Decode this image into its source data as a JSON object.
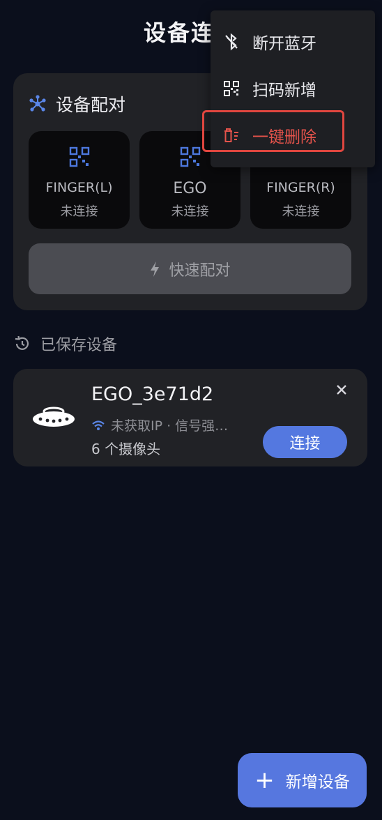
{
  "header": {
    "title": "设备连接"
  },
  "pairing": {
    "title": "设备配对",
    "devices": [
      {
        "name": "FINGER(L)",
        "status": "未连接"
      },
      {
        "name": "EGO",
        "status": "未连接"
      },
      {
        "name": "FINGER(R)",
        "status": "未连接"
      }
    ],
    "quick_pair_label": "快速配对"
  },
  "saved": {
    "title": "已保存设备",
    "device": {
      "name": "EGO_3e71d2",
      "meta": "未获取IP · 信号强…",
      "cameras": "6 个摄像头",
      "connect_label": "连接"
    }
  },
  "fab": {
    "label": "新增设备"
  },
  "menu": {
    "items": [
      {
        "label": "断开蓝牙",
        "icon": "bluetooth-off-icon"
      },
      {
        "label": "扫码新增",
        "icon": "qr-scan-icon"
      },
      {
        "label": "一键删除",
        "icon": "delete-all-icon"
      }
    ]
  },
  "colors": {
    "accent": "#5677df",
    "danger": "#e5534b",
    "background": "#0b0f1c",
    "card": "#212226"
  }
}
